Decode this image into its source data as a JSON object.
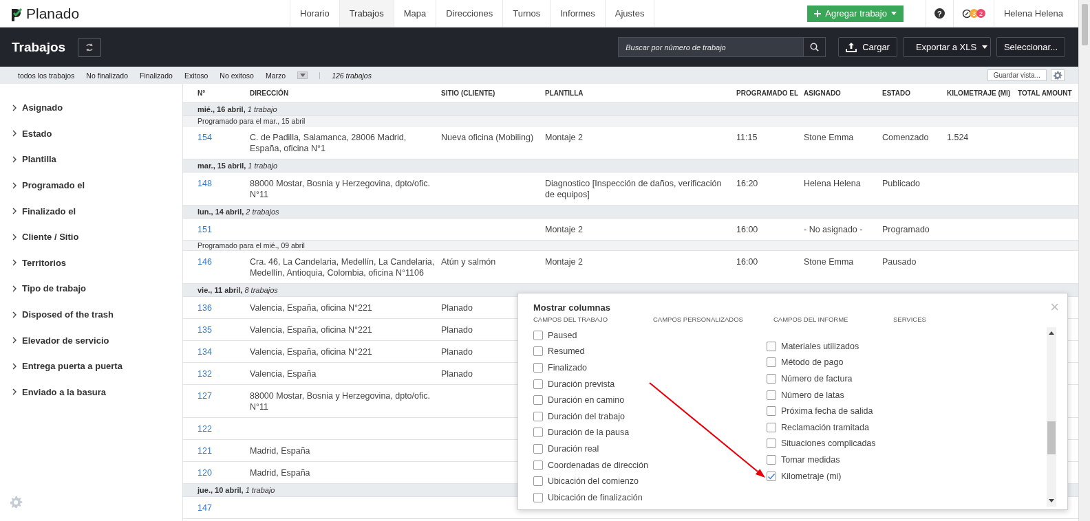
{
  "app": {
    "logo": "Planado"
  },
  "nav": [
    {
      "label": "Horario",
      "selected": false
    },
    {
      "label": "Trabajos",
      "selected": true
    },
    {
      "label": "Mapa",
      "selected": false
    },
    {
      "label": "Direcciones",
      "selected": false
    },
    {
      "label": "Turnos",
      "selected": false
    },
    {
      "label": "Informes",
      "selected": false
    },
    {
      "label": "Ajustes",
      "selected": false
    }
  ],
  "add_button": "Agregar trabajo",
  "help_button": "?",
  "notifications": [
    {
      "count": "3",
      "color": "#f5a93a"
    },
    {
      "count": "2",
      "color": "#f0466b"
    }
  ],
  "user": "Helena Helena",
  "page_title": "Trabajos",
  "search": {
    "placeholder": "Buscar por número de trabajo"
  },
  "upload_button": "Cargar",
  "export_button": "Exportar a XLS",
  "select_button": "Seleccionar...",
  "filters": [
    "todos los trabajos",
    "No finalizado",
    "Finalizado",
    "Exitoso",
    "No exitoso",
    "Marzo"
  ],
  "job_count": "126 trabajos",
  "save_view_button": "Guardar vista...",
  "sidebar": {
    "items": [
      {
        "label": "Asignado",
        "expanded": false
      },
      {
        "label": "Estado",
        "expanded": false
      },
      {
        "label": "Plantilla",
        "expanded": false
      },
      {
        "label": "Programado el",
        "expanded": false
      },
      {
        "label": "Finalizado el",
        "expanded": false
      },
      {
        "label": "Cliente / Sitio",
        "expanded": false
      },
      {
        "label": "Territorios",
        "expanded": false
      },
      {
        "label": "Tipo de trabajo",
        "expanded": false
      },
      {
        "label": "Disposed of the trash",
        "expanded": false
      },
      {
        "label": "Elevador de servicio",
        "expanded": false
      },
      {
        "label": "Entrega puerta a puerta",
        "expanded": false
      },
      {
        "label": "Enviado a la basura",
        "expanded": false
      }
    ]
  },
  "table": {
    "columns": [
      "N°",
      "DIRECCIÓN",
      "SITIO (CLIENTE)",
      "PLANTILLA",
      "PROGRAMADO EL",
      "ASIGNADO",
      "ESTADO",
      "KILOMETRAJE (MI)",
      "TOTAL AMOUNT"
    ],
    "rows": [
      {
        "kind": "date",
        "date": "mié., 16 abril,",
        "count": "1 trabajo"
      },
      {
        "kind": "note",
        "text": "Programado para el mar., 15 abril"
      },
      {
        "kind": "job",
        "number": "154",
        "address": "C. de Padilla, Salamanca, 28006 Madrid, España, oficina N°1",
        "site": "Nueva oficina (Mobiling)",
        "template": "Montaje 2",
        "scheduled": "11:15",
        "assigned": "Stone Emma",
        "status": "Comenzado",
        "mileage": "1.524"
      },
      {
        "kind": "date",
        "date": "mar., 15 abril,",
        "count": "1 trabajo"
      },
      {
        "kind": "job",
        "number": "148",
        "address": "88000 Mostar, Bosnia y Herzegovina, dpto/ofic. N°11",
        "template": "Diagnostico [Inspección de daños, verificación de equipos]",
        "scheduled": "16:20",
        "assigned": "Helena Helena",
        "status": "Publicado"
      },
      {
        "kind": "date",
        "date": "lun., 14 abril,",
        "count": "2 trabajos"
      },
      {
        "kind": "job",
        "number": "151",
        "template": "Montaje 2",
        "scheduled": "16:00",
        "assigned": "- No asignado -",
        "status": "Programado"
      },
      {
        "kind": "note",
        "text": "Programado para el mié., 09 abril"
      },
      {
        "kind": "job",
        "number": "146",
        "address": "Cra. 46, La Candelaria, Medellín, La Candelaria, Medellín, Antioquia, Colombia, oficina N°1106",
        "site": "Atún y salmón",
        "template": "Montaje 2",
        "scheduled": "16:00",
        "assigned": "Stone Emma",
        "status": "Pausado"
      },
      {
        "kind": "date",
        "date": "vie., 11 abril,",
        "count": "8 trabajos"
      },
      {
        "kind": "job",
        "number": "136",
        "address": "Valencia, España, oficina N°221",
        "site": "Planado"
      },
      {
        "kind": "job",
        "number": "135",
        "address": "Valencia, España, oficina N°221",
        "site": "Planado"
      },
      {
        "kind": "job",
        "number": "134",
        "address": "Valencia, España, oficina N°221",
        "site": "Planado"
      },
      {
        "kind": "job",
        "number": "132",
        "address": "Valencia, España",
        "site": "Planado"
      },
      {
        "kind": "job",
        "number": "127",
        "address": "88000 Mostar, Bosnia y Herzegovina, dpto/ofic. N°11"
      },
      {
        "kind": "job",
        "number": "122"
      },
      {
        "kind": "job",
        "number": "121",
        "address": "Madrid, España"
      },
      {
        "kind": "job",
        "number": "120",
        "address": "Madrid, España"
      },
      {
        "kind": "date",
        "date": "jue., 10 abril,",
        "count": "1 trabajo"
      },
      {
        "kind": "job",
        "number": "147"
      }
    ]
  },
  "columns_dialog": {
    "title": "Mostrar columnas",
    "close": "×",
    "groups": [
      {
        "heading": "CAMPOS DEL TRABAJO",
        "items": [
          {
            "label": "Paused",
            "checked": false
          },
          {
            "label": "Resumed",
            "checked": false
          },
          {
            "label": "Finalizado",
            "checked": false
          },
          {
            "label": "Duración prevista",
            "checked": false
          },
          {
            "label": "Duración en camino",
            "checked": false
          },
          {
            "label": "Duración del trabajo",
            "checked": false
          },
          {
            "label": "Duración de la pausa",
            "checked": false
          },
          {
            "label": "Duración real",
            "checked": false
          },
          {
            "label": "Coordenadas de dirección",
            "checked": false
          },
          {
            "label": "Ubicación del comienzo",
            "checked": false
          },
          {
            "label": "Ubicación de finalización",
            "checked": false
          }
        ]
      },
      {
        "heading": "CAMPOS PERSONALIZADOS"
      },
      {
        "heading": "CAMPOS DEL INFORME",
        "items": [
          {
            "label": "Materiales utilizados",
            "checked": false
          },
          {
            "label": "Método de pago",
            "checked": false
          },
          {
            "label": "Número de factura",
            "checked": false
          },
          {
            "label": "Número de latas",
            "checked": false
          },
          {
            "label": "Próxima fecha de salida",
            "checked": false
          },
          {
            "label": "Reclamación tramitada",
            "checked": false
          },
          {
            "label": "Situaciones complicadas",
            "checked": false
          },
          {
            "label": "Tomar medidas",
            "checked": false
          },
          {
            "label": "Kilometraje (mi)",
            "checked": true
          }
        ]
      },
      {
        "heading": "SERVICES"
      }
    ]
  }
}
